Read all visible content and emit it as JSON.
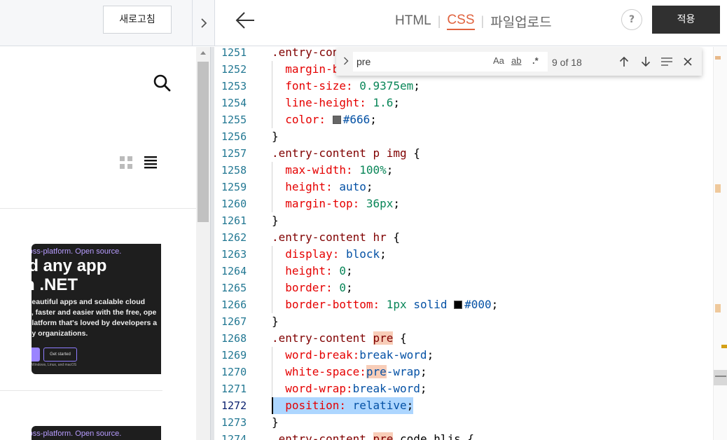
{
  "left_panel": {
    "refresh_label": "새로고침",
    "preview_cards": [
      {
        "tag": "ross-platform. Open source.",
        "headline_lines": [
          "ild any app",
          "th .NET"
        ],
        "body_lines": [
          "beautiful apps and scalable cloud",
          "s, faster and easier with the free, ope",
          "platform that's loved by developers a",
          " by organizations."
        ],
        "button_label": "Get started",
        "note": "Windows, Linux, and macOS"
      },
      {
        "tag": "ross-platform. Open source."
      }
    ]
  },
  "header": {
    "tabs": [
      {
        "label": "HTML",
        "active": false
      },
      {
        "label": "CSS",
        "active": true
      },
      {
        "label": "파일업로드",
        "active": false
      }
    ],
    "help_label": "?",
    "apply_label": "적용",
    "accent_color": "#e0633f"
  },
  "find_widget": {
    "query": "pre",
    "match_case_label": "Aa",
    "whole_word_label": "ab",
    "regex_label": ".*",
    "count": "9 of 18"
  },
  "editor": {
    "current_line": 1272,
    "lines": [
      {
        "n": "1251",
        "tokens": [
          {
            "t": ".entry-con",
            "c": "sel"
          }
        ]
      },
      {
        "n": "1252",
        "tokens": [
          {
            "t": "  margin-b",
            "c": "prop"
          }
        ]
      },
      {
        "n": "1253",
        "tokens": [
          {
            "t": "  font-size:",
            "c": "prop"
          },
          {
            "t": " ",
            "c": "punc"
          },
          {
            "t": "0.9375em",
            "c": "num"
          },
          {
            "t": ";",
            "c": "punc"
          }
        ]
      },
      {
        "n": "1254",
        "tokens": [
          {
            "t": "  line-height:",
            "c": "prop"
          },
          {
            "t": " ",
            "c": "punc"
          },
          {
            "t": "1.6",
            "c": "num"
          },
          {
            "t": ";",
            "c": "punc"
          }
        ]
      },
      {
        "n": "1255",
        "tokens": [
          {
            "t": "  color:",
            "c": "prop"
          },
          {
            "t": " ",
            "c": "punc"
          },
          {
            "t": "",
            "c": "swatch",
            "color": "#666666"
          },
          {
            "t": "#666",
            "c": "val"
          },
          {
            "t": ";",
            "c": "punc"
          }
        ]
      },
      {
        "n": "1256",
        "tokens": [
          {
            "t": "}",
            "c": "punc"
          }
        ]
      },
      {
        "n": "1257",
        "tokens": [
          {
            "t": ".entry-content p img",
            "c": "sel"
          },
          {
            "t": " {",
            "c": "punc"
          }
        ]
      },
      {
        "n": "1258",
        "tokens": [
          {
            "t": "  max-width:",
            "c": "prop"
          },
          {
            "t": " ",
            "c": "punc"
          },
          {
            "t": "100%",
            "c": "num"
          },
          {
            "t": ";",
            "c": "punc"
          }
        ]
      },
      {
        "n": "1259",
        "tokens": [
          {
            "t": "  height:",
            "c": "prop"
          },
          {
            "t": " ",
            "c": "punc"
          },
          {
            "t": "auto",
            "c": "val"
          },
          {
            "t": ";",
            "c": "punc"
          }
        ]
      },
      {
        "n": "1260",
        "tokens": [
          {
            "t": "  margin-top:",
            "c": "prop"
          },
          {
            "t": " ",
            "c": "punc"
          },
          {
            "t": "36px",
            "c": "num"
          },
          {
            "t": ";",
            "c": "punc"
          }
        ]
      },
      {
        "n": "1261",
        "tokens": [
          {
            "t": "}",
            "c": "punc"
          }
        ]
      },
      {
        "n": "1262",
        "tokens": [
          {
            "t": ".entry-content hr",
            "c": "sel"
          },
          {
            "t": " {",
            "c": "punc"
          }
        ]
      },
      {
        "n": "1263",
        "tokens": [
          {
            "t": "  display:",
            "c": "prop"
          },
          {
            "t": " ",
            "c": "punc"
          },
          {
            "t": "block",
            "c": "val"
          },
          {
            "t": ";",
            "c": "punc"
          }
        ]
      },
      {
        "n": "1264",
        "tokens": [
          {
            "t": "  height:",
            "c": "prop"
          },
          {
            "t": " ",
            "c": "punc"
          },
          {
            "t": "0",
            "c": "num"
          },
          {
            "t": ";",
            "c": "punc"
          }
        ]
      },
      {
        "n": "1265",
        "tokens": [
          {
            "t": "  border:",
            "c": "prop"
          },
          {
            "t": " ",
            "c": "punc"
          },
          {
            "t": "0",
            "c": "num"
          },
          {
            "t": ";",
            "c": "punc"
          }
        ]
      },
      {
        "n": "1266",
        "tokens": [
          {
            "t": "  border-bottom:",
            "c": "prop"
          },
          {
            "t": " ",
            "c": "punc"
          },
          {
            "t": "1px",
            "c": "num"
          },
          {
            "t": " ",
            "c": "punc"
          },
          {
            "t": "solid",
            "c": "val"
          },
          {
            "t": " ",
            "c": "punc"
          },
          {
            "t": "",
            "c": "swatch",
            "color": "#000000"
          },
          {
            "t": "#000",
            "c": "val"
          },
          {
            "t": ";",
            "c": "punc"
          }
        ]
      },
      {
        "n": "1267",
        "tokens": [
          {
            "t": "}",
            "c": "punc"
          }
        ]
      },
      {
        "n": "1268",
        "tokens": [
          {
            "t": ".entry-content ",
            "c": "sel"
          },
          {
            "t": "pre",
            "c": "sel hl"
          },
          {
            "t": " {",
            "c": "punc"
          }
        ]
      },
      {
        "n": "1269",
        "tokens": [
          {
            "t": "  word-break:",
            "c": "prop"
          },
          {
            "t": "break-word",
            "c": "val"
          },
          {
            "t": ";",
            "c": "punc"
          }
        ]
      },
      {
        "n": "1270",
        "tokens": [
          {
            "t": "  white-space:",
            "c": "prop"
          },
          {
            "t": "pre",
            "c": "val hl"
          },
          {
            "t": "-wrap",
            "c": "val"
          },
          {
            "t": ";",
            "c": "punc"
          }
        ]
      },
      {
        "n": "1271",
        "tokens": [
          {
            "t": "  word-wrap:",
            "c": "prop"
          },
          {
            "t": "break-word",
            "c": "val"
          },
          {
            "t": ";",
            "c": "punc"
          }
        ]
      },
      {
        "n": "1272",
        "tokens": [
          {
            "t": "  position:",
            "c": "prop"
          },
          {
            "t": " ",
            "c": "punc"
          },
          {
            "t": "relative",
            "c": "val"
          },
          {
            "t": ";",
            "c": "punc"
          }
        ]
      },
      {
        "n": "1273",
        "tokens": [
          {
            "t": "}",
            "c": "punc"
          }
        ]
      },
      {
        "n": "1274",
        "tokens": [
          {
            "t": ".entry-content ",
            "c": "sel"
          },
          {
            "t": "pre",
            "c": "sel hl"
          },
          {
            "t": " code.hljs {",
            "c": "punc"
          }
        ]
      }
    ]
  }
}
